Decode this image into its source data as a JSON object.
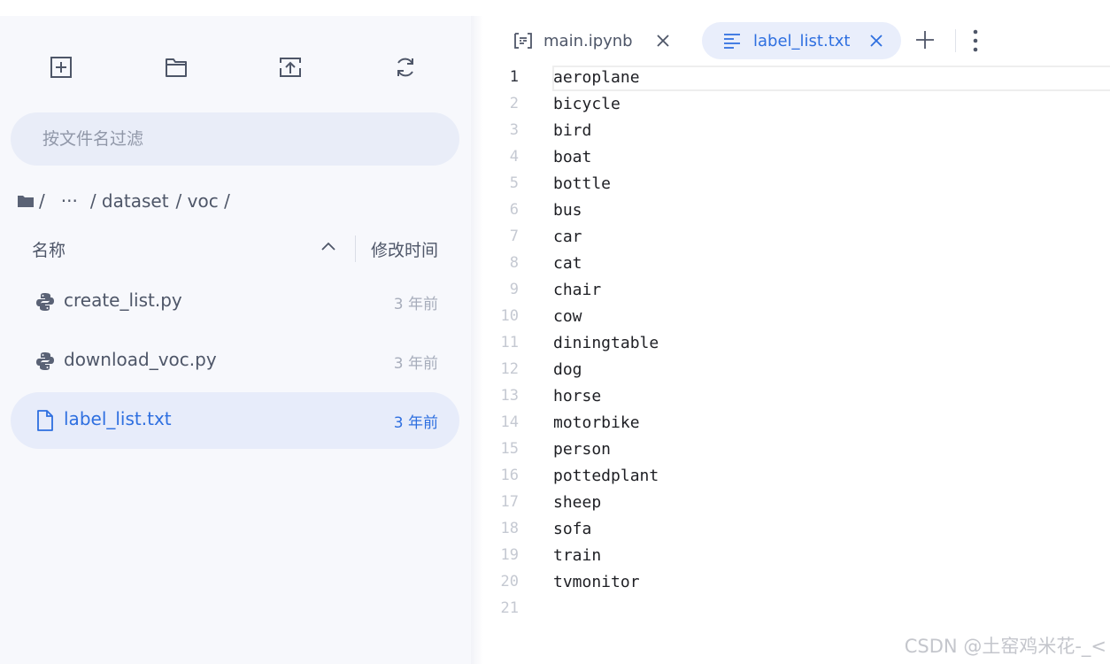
{
  "sidebar": {
    "toolbar": [
      {
        "name": "new-launcher-button",
        "icon": "plus-square-icon"
      },
      {
        "name": "new-folder-button",
        "icon": "folder-icon"
      },
      {
        "name": "upload-button",
        "icon": "upload-icon"
      },
      {
        "name": "refresh-button",
        "icon": "refresh-icon"
      }
    ],
    "search": {
      "placeholder": "按文件名过滤",
      "value": ""
    },
    "breadcrumb": {
      "root_sep": "/",
      "ellipsis": "···",
      "seg1": "/ dataset",
      "seg2": "/ voc /"
    },
    "columns": {
      "name": "名称",
      "modified": "修改时间"
    },
    "files": [
      {
        "name": "create_list.py",
        "modified": "3 年前",
        "type": "python",
        "active": false
      },
      {
        "name": "download_voc.py",
        "modified": "3 年前",
        "type": "python",
        "active": false
      },
      {
        "name": "label_list.txt",
        "modified": "3 年前",
        "type": "text",
        "active": true
      }
    ]
  },
  "tabs": [
    {
      "label": "main.ipynb",
      "icon": "notebook-icon",
      "active": false
    },
    {
      "label": "label_list.txt",
      "icon": "text-file-icon",
      "active": true
    }
  ],
  "editor": {
    "current_line": 1,
    "lines": [
      "aeroplane",
      "bicycle",
      "bird",
      "boat",
      "bottle",
      "bus",
      "car",
      "cat",
      "chair",
      "cow",
      "diningtable",
      "dog",
      "horse",
      "motorbike",
      "person",
      "pottedplant",
      "sheep",
      "sofa",
      "train",
      "tvmonitor",
      ""
    ]
  },
  "watermark": "CSDN @土窑鸡米花-_<",
  "colors": {
    "accent": "#2e6fe0",
    "sidebar_bg": "#f7f8fc",
    "active_row": "#e7ecfa",
    "text": "#4e5668"
  }
}
